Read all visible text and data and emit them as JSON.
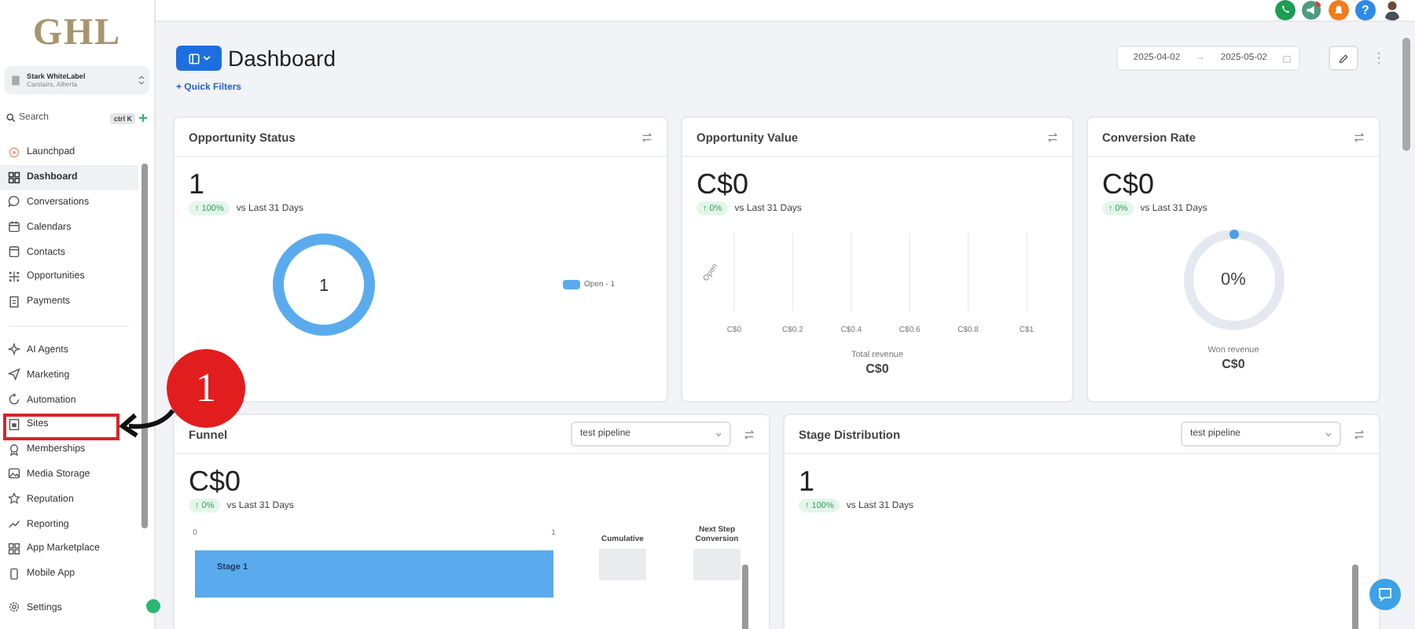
{
  "sidebar": {
    "logo": "GHL",
    "account": {
      "name": "Stark WhiteLabel",
      "location": "Carstairs, Alberta"
    },
    "search": {
      "placeholder": "Search",
      "shortcut": "ctrl K"
    },
    "nav_groups": [
      [
        {
          "label": "Launchpad",
          "selected": false
        },
        {
          "label": "Dashboard",
          "selected": true
        },
        {
          "label": "Conversations",
          "selected": false
        },
        {
          "label": "Calendars",
          "selected": false
        },
        {
          "label": "Contacts",
          "selected": false
        },
        {
          "label": "Opportunities",
          "selected": false
        },
        {
          "label": "Payments",
          "selected": false
        }
      ],
      [
        {
          "label": "AI Agents",
          "selected": false
        },
        {
          "label": "Marketing",
          "selected": false
        },
        {
          "label": "Automation",
          "selected": false
        },
        {
          "label": "Sites",
          "selected": false
        },
        {
          "label": "Memberships",
          "selected": false
        },
        {
          "label": "Media Storage",
          "selected": false
        },
        {
          "label": "Reputation",
          "selected": false
        },
        {
          "label": "Reporting",
          "selected": false
        },
        {
          "label": "App Marketplace",
          "selected": false
        },
        {
          "label": "Mobile App",
          "selected": false
        }
      ]
    ],
    "settings": {
      "label": "Settings",
      "selected": false
    }
  },
  "top_bar": {
    "help": "?"
  },
  "header": {
    "title": "Dashboard",
    "quick_filters": "+ Quick Filters",
    "date_from": "2025-04-02",
    "date_arrow": "→",
    "date_to": "2025-05-02"
  },
  "widgets": [
    {
      "kind": "donut",
      "title": "Opportunity Status",
      "value": "1",
      "change": "↑ 100%",
      "compare": "vs Last 31 Days",
      "center": "1",
      "legend": [
        "Open - 1"
      ]
    },
    {
      "kind": "bars",
      "title": "Opportunity Value",
      "value": "C$0",
      "change": "↑ 0%",
      "compare": "vs Last 31 Days",
      "total_label": "Total revenue",
      "total": "C$0",
      "axis_category": "Open",
      "axis_labels": [
        "C$0",
        "C$0.2",
        "C$0.4",
        "C$0.6",
        "C$0.8",
        "C$1"
      ]
    },
    {
      "kind": "gauge",
      "title": "Conversion Rate",
      "value": "C$0",
      "change": "↑ 0%",
      "compare": "vs Last 31 Days",
      "reading": "0%",
      "total_label": "Won revenue",
      "total": "C$0"
    },
    {
      "kind": "funnel",
      "title": "Funnel",
      "pipeline": "test pipeline",
      "value": "C$0",
      "change": "↑ 0%",
      "compare": "vs Last 31 Days",
      "columns": [
        "Cumulative",
        "Next Step Conversion"
      ],
      "axis_labels": [
        "0",
        "1"
      ],
      "stages": [
        "Stage 1"
      ]
    },
    {
      "kind": "stage",
      "title": "Stage Distribution",
      "pipeline": "test pipeline",
      "value": "1",
      "change": "↑ 100%",
      "compare": "vs Last 31 Days"
    }
  ],
  "annotation": {
    "number": "1"
  }
}
